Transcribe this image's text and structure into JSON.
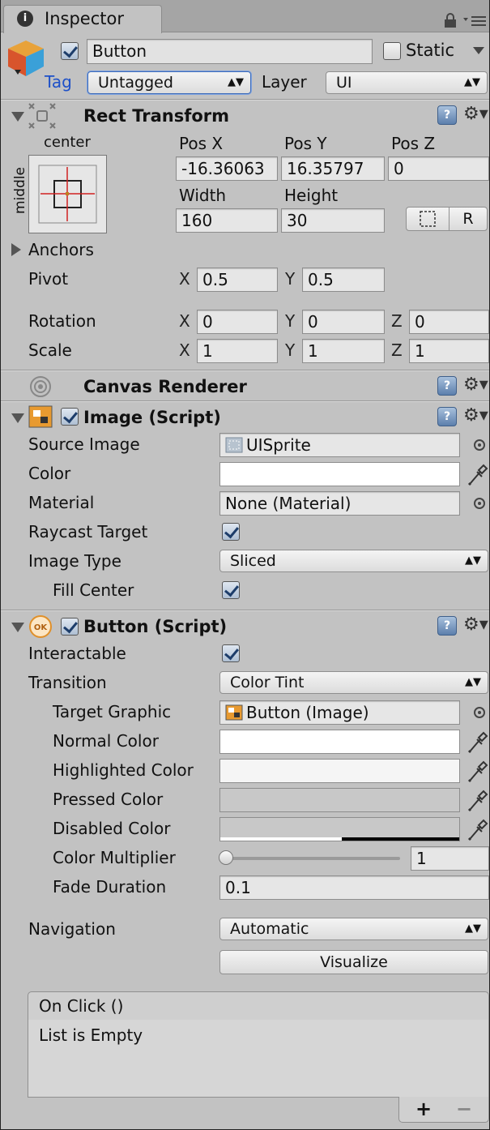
{
  "tab": {
    "title": "Inspector"
  },
  "header": {
    "object_name": "Button",
    "active": true,
    "static_label": "Static",
    "tag_label": "Tag",
    "tag_value": "Untagged",
    "layer_label": "Layer",
    "layer_value": "UI"
  },
  "rect_transform": {
    "title": "Rect Transform",
    "anchor_h": "center",
    "anchor_v": "middle",
    "pos_x_label": "Pos X",
    "pos_y_label": "Pos Y",
    "pos_z_label": "Pos Z",
    "pos_x": "-16.36063",
    "pos_y": "16.35797",
    "pos_z": "0",
    "width_label": "Width",
    "height_label": "Height",
    "width": "160",
    "height": "30",
    "raw_button": "R",
    "anchors_label": "Anchors",
    "pivot_label": "Pivot",
    "pivot_x": "0.5",
    "pivot_y": "0.5",
    "rotation_label": "Rotation",
    "rot_x": "0",
    "rot_y": "0",
    "rot_z": "0",
    "scale_label": "Scale",
    "scale_x": "1",
    "scale_y": "1",
    "scale_z": "1",
    "x": "X",
    "y": "Y",
    "z": "Z"
  },
  "canvas_renderer": {
    "title": "Canvas Renderer"
  },
  "image": {
    "title": "Image (Script)",
    "enabled": true,
    "source_image_label": "Source Image",
    "source_image": "UISprite",
    "color_label": "Color",
    "color": "#ffffff",
    "material_label": "Material",
    "material": "None (Material)",
    "raycast_label": "Raycast Target",
    "raycast": true,
    "image_type_label": "Image Type",
    "image_type": "Sliced",
    "fill_center_label": "Fill Center",
    "fill_center": true
  },
  "button": {
    "title": "Button (Script)",
    "enabled": true,
    "interactable_label": "Interactable",
    "interactable": true,
    "transition_label": "Transition",
    "transition": "Color Tint",
    "target_graphic_label": "Target Graphic",
    "target_graphic": "Button (Image)",
    "normal_color_label": "Normal Color",
    "normal_color": "#ffffff",
    "highlighted_color_label": "Highlighted Color",
    "highlighted_color": "#f5f5f5",
    "pressed_color_label": "Pressed Color",
    "pressed_color": "#c8c8c8",
    "disabled_color_label": "Disabled Color",
    "disabled_color": "#c8c8c8",
    "color_multiplier_label": "Color Multiplier",
    "color_multiplier": "1",
    "fade_duration_label": "Fade Duration",
    "fade_duration": "0.1",
    "navigation_label": "Navigation",
    "navigation": "Automatic",
    "visualize_label": "Visualize",
    "onclick_title": "On Click ()",
    "onclick_empty": "List is Empty",
    "add_label": "+",
    "remove_label": "−"
  },
  "icons": {
    "info": "info-icon",
    "lock": "lock-icon",
    "menu": "menu-icon",
    "cube": "gameobject-cube-icon",
    "help": "help-book-icon",
    "gear": "gear-icon",
    "eyedropper": "eyedropper-icon",
    "picker": "object-picker-icon"
  }
}
